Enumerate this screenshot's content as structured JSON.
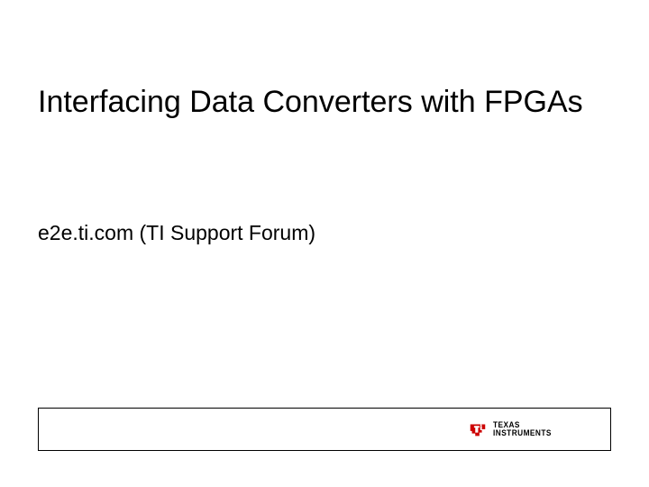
{
  "title": "Interfacing Data Converters with FPGAs",
  "subtitle": "e2e.ti.com (TI Support Forum)",
  "logo": {
    "line1": "TEXAS",
    "line2": "INSTRUMENTS",
    "color": "#cc0000"
  }
}
